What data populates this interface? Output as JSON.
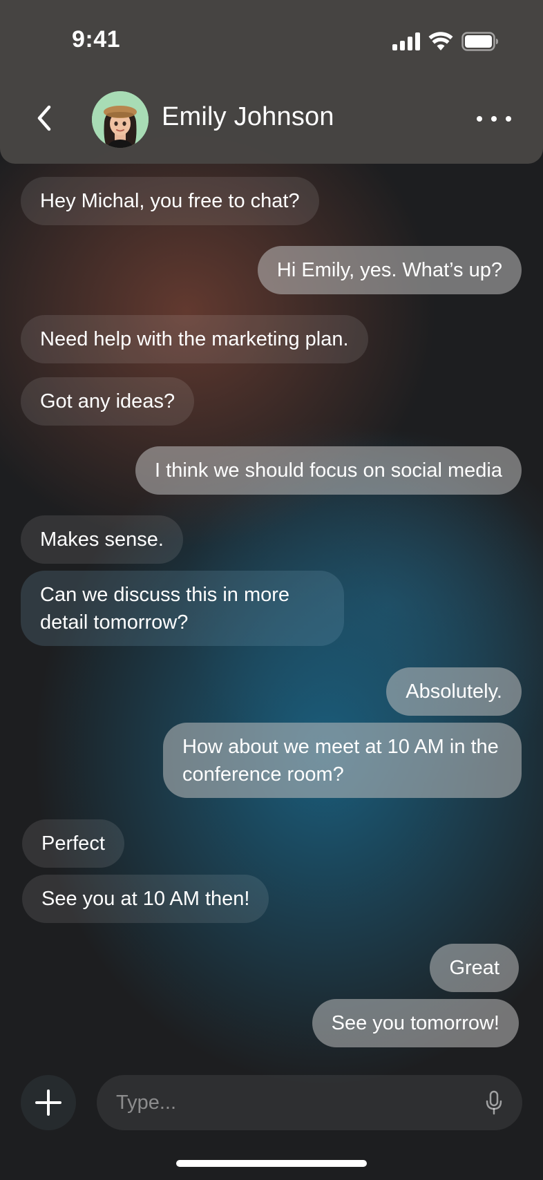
{
  "status_bar": {
    "time": "9:41"
  },
  "header": {
    "contact_name": "Emily Johnson"
  },
  "messages": [
    {
      "from": "them",
      "text": "Hey Michal, you free to chat?"
    },
    {
      "from": "me",
      "text": "Hi Emily, yes. What’s up?"
    },
    {
      "from": "them",
      "text": "Need help with the marketing plan."
    },
    {
      "from": "them",
      "text": "Got any ideas?"
    },
    {
      "from": "me",
      "text": "I think we should focus on social media"
    },
    {
      "from": "them",
      "text": "Makes sense."
    },
    {
      "from": "them",
      "text": "Can we discuss this in more detail tomorrow?"
    },
    {
      "from": "me",
      "text": "Absolutely."
    },
    {
      "from": "me",
      "text": "How about we meet at 10 AM in the conference room?"
    },
    {
      "from": "them",
      "text": "Perfect"
    },
    {
      "from": "them",
      "text": "See you at 10 AM then!"
    },
    {
      "from": "me",
      "text": "Great"
    },
    {
      "from": "me",
      "text": "See you tomorrow!"
    }
  ],
  "composer": {
    "placeholder": "Type..."
  },
  "icons": {
    "back": "chevron-left-icon",
    "more": "more-horizontal-icon",
    "add": "plus-icon",
    "mic": "microphone-icon",
    "signal": "signal-icon",
    "wifi": "wifi-icon",
    "battery": "battery-icon"
  }
}
